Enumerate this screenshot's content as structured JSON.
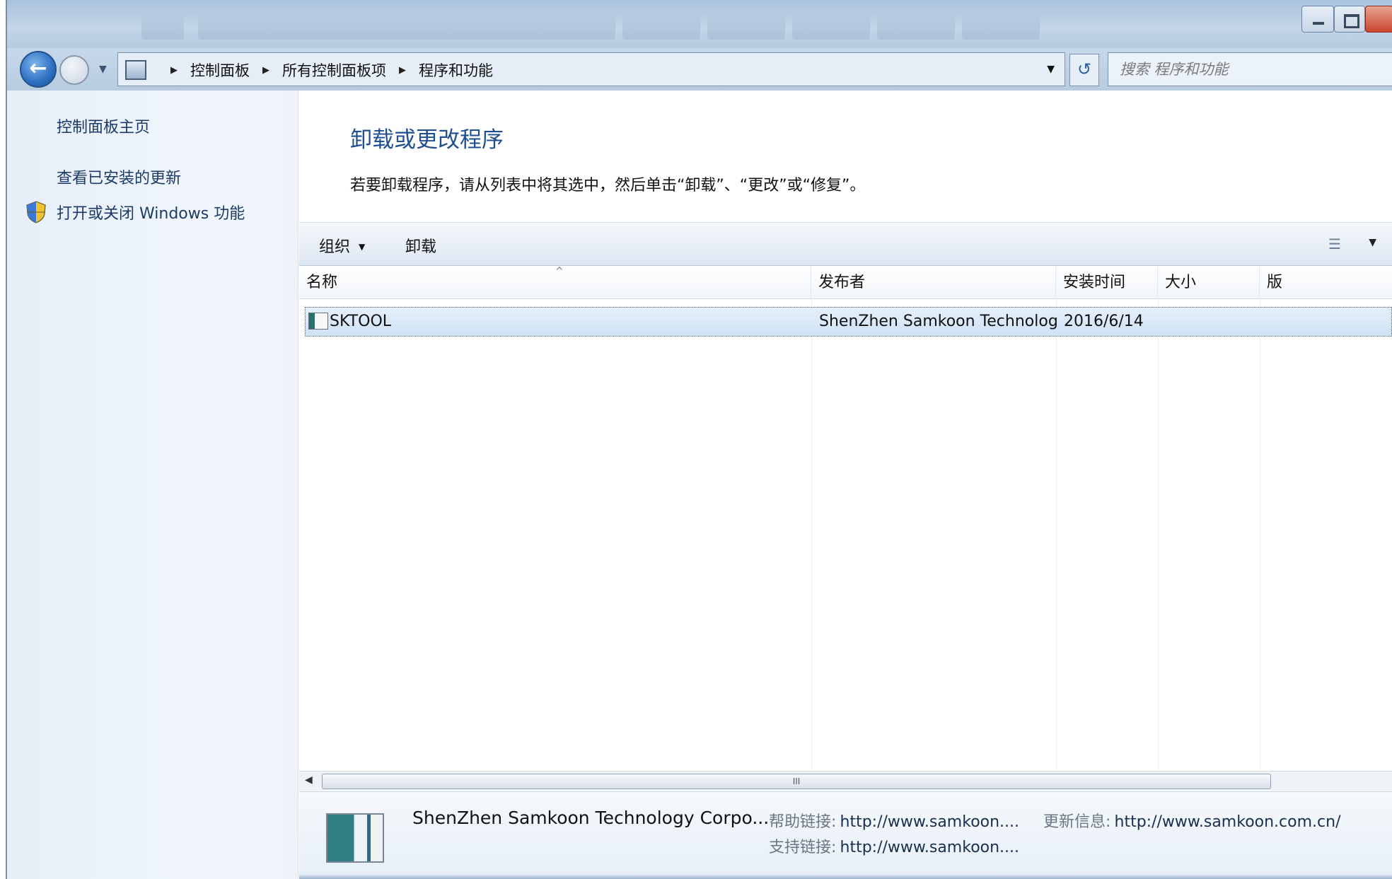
{
  "nav": {
    "breadcrumbs": [
      "控制面板",
      "所有控制面板项",
      "程序和功能"
    ],
    "search_placeholder": "搜索 程序和功能"
  },
  "sidebar": {
    "items": [
      {
        "label": "控制面板主页"
      },
      {
        "label": "查看已安装的更新"
      },
      {
        "label": "打开或关闭 Windows 功能"
      }
    ]
  },
  "main": {
    "title": "卸载或更改程序",
    "description": "若要卸载程序，请从列表中将其选中，然后单击“卸载”、“更改”或“修复”。"
  },
  "toolbar": {
    "organize_label": "组织",
    "uninstall_label": "卸载"
  },
  "list": {
    "columns": [
      "名称",
      "发布者",
      "安装时间",
      "大小",
      "版"
    ],
    "rows": [
      {
        "name": "SKTOOL",
        "publisher": "ShenZhen Samkoon Technology ...",
        "installed": "2016/6/14",
        "size": ""
      }
    ]
  },
  "scrollbar": {
    "thumb_label": "III"
  },
  "details": {
    "publisher": "ShenZhen Samkoon Technology Corpo...",
    "help_label": "帮助链接:",
    "help_value": "http://www.samkoon....",
    "update_label": "更新信息:",
    "update_value": "http://www.samkoon.com.cn/",
    "support_label": "支持链接:",
    "support_value": "http://www.samkoon...."
  },
  "colors": {
    "accent": "#1f4f8f",
    "selection": "#cfe1f5",
    "sidebar_bg": "#e6eef8"
  }
}
